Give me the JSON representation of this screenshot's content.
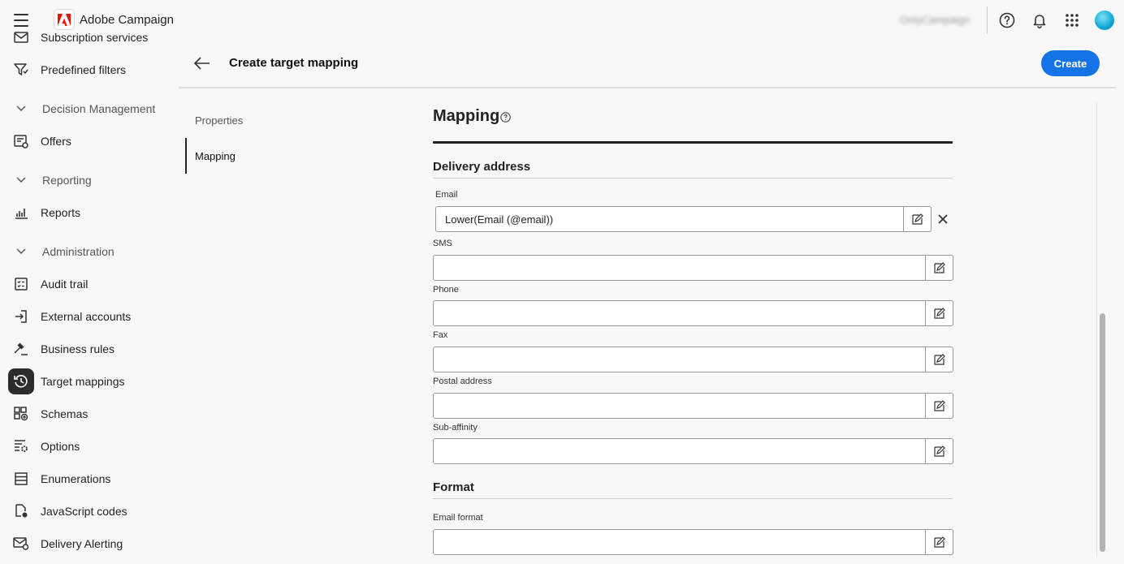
{
  "app": {
    "name": "Adobe Campaign",
    "org": "OnlyCampaign"
  },
  "page": {
    "title": "Create target mapping",
    "create_label": "Create"
  },
  "sidebar": {
    "items": [
      {
        "label": "Subscription services",
        "icon": "envelope-icon"
      },
      {
        "label": "Predefined filters",
        "icon": "filter-icon"
      },
      {
        "label": "Decision Management",
        "group": true
      },
      {
        "label": "Offers",
        "icon": "offers-icon"
      },
      {
        "label": "Reporting",
        "group": true
      },
      {
        "label": "Reports",
        "icon": "bar-chart-icon"
      },
      {
        "label": "Administration",
        "group": true
      },
      {
        "label": "Audit trail",
        "icon": "audit-icon"
      },
      {
        "label": "External accounts",
        "icon": "login-icon"
      },
      {
        "label": "Business rules",
        "icon": "gavel-icon"
      },
      {
        "label": "Target mappings",
        "icon": "target-mapping-icon",
        "active": true
      },
      {
        "label": "Schemas",
        "icon": "schemas-icon"
      },
      {
        "label": "Options",
        "icon": "options-icon"
      },
      {
        "label": "Enumerations",
        "icon": "list-icon"
      },
      {
        "label": "JavaScript codes",
        "icon": "code-icon"
      },
      {
        "label": "Delivery Alerting",
        "icon": "alert-mail-icon"
      }
    ]
  },
  "steps": [
    {
      "label": "Properties"
    },
    {
      "label": "Mapping"
    }
  ],
  "mapping": {
    "title": "Mapping",
    "delivery_title": "Delivery address",
    "format_title": "Format",
    "fields": {
      "email": {
        "label": "Email",
        "value": "Lower(Email (@email))"
      },
      "sms": {
        "label": "SMS",
        "value": ""
      },
      "phone": {
        "label": "Phone",
        "value": ""
      },
      "fax": {
        "label": "Fax",
        "value": ""
      },
      "postal": {
        "label": "Postal address",
        "value": ""
      },
      "subaffinity": {
        "label": "Sub-affinity",
        "value": ""
      },
      "email_format": {
        "label": "Email format",
        "value": ""
      }
    }
  },
  "colors": {
    "accent": "#1473e6",
    "text": "#222222",
    "background": "#f8f8f8"
  }
}
